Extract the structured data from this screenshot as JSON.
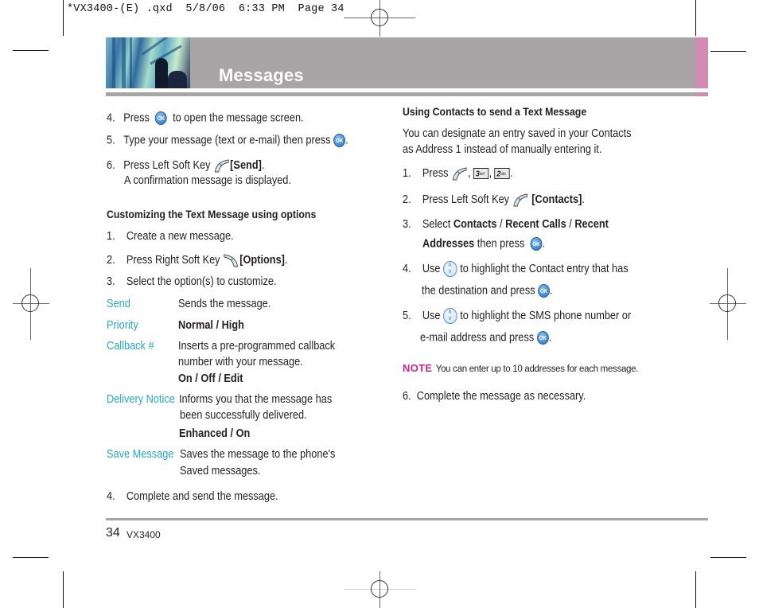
{
  "slug_line": "*VX3400-(E) .qxd  5/8/06  6:33 PM  Page 34",
  "header": {
    "title": "Messages",
    "colors": {
      "bar": "#a7a5a6",
      "accent": "#d48bb3",
      "title": "#ffffff"
    }
  },
  "left_column": {
    "steps_top": [
      {
        "num": "4.",
        "before": "Press",
        "icon": "ok-icon",
        "after": "to open the message screen."
      },
      {
        "num": "5.",
        "before": "Type your message (text or e-mail) then press",
        "icon": "ok-icon",
        "after": "."
      },
      {
        "num": "6.",
        "before": "Press Left Soft Key",
        "icon": "left-soft-key-icon",
        "bold": "[Send]",
        "after": ".",
        "line2": "A confirmation message is displayed."
      }
    ],
    "section_heading": "Customizing the Text Message using options",
    "steps_options": [
      {
        "num": "1.",
        "text": "Create a new message."
      },
      {
        "num": "2.",
        "before": "Press Right Soft Key",
        "icon": "right-soft-key-icon",
        "bold": "[Options]",
        "after": "."
      },
      {
        "num": "3.",
        "text": "Select the option(s) to customize."
      }
    ],
    "options": [
      {
        "label": "Send",
        "desc": "Sends the message."
      },
      {
        "label": "Priority",
        "values": "Normal / High"
      },
      {
        "label": "Callback #",
        "desc_line1": "Inserts a pre-programmed callback",
        "desc_line2": "number with your message.",
        "values": "On / Off / Edit"
      },
      {
        "label": "Delivery Notice",
        "desc_line1": "Informs you that the message has",
        "desc_line2": "been successfully delivered.",
        "values": "Enhanced / On"
      },
      {
        "label": "Save Message",
        "desc_line1": "Saves the message to the phone's",
        "desc_line2": "Saved messages."
      }
    ],
    "final_step": {
      "num": "4.",
      "text": "Complete and send the message."
    }
  },
  "right_column": {
    "section_heading": "Using Contacts to send a Text Message",
    "intro_line1": "You can designate an entry saved in your Contacts",
    "intro_line2": "as Address 1 instead of manually entering it.",
    "steps": [
      {
        "num": "1.",
        "before": "Press",
        "keys": [
          "left-soft-key-icon",
          "3 def",
          "2 abc"
        ],
        "key3_main": "3",
        "key3_sub": "def",
        "key2_main": "2",
        "key2_sub": "abc"
      },
      {
        "num": "2.",
        "before": "Press Left Soft Key",
        "bold": "[Contacts]",
        "after": "."
      },
      {
        "num": "3.",
        "before": "Select",
        "bold1": "Contacts",
        "sep1": " / ",
        "bold2": "Recent Calls",
        "sep2": " / ",
        "bold3": "Recent",
        "bold4": "Addresses",
        "after": "then press",
        "end": "."
      },
      {
        "num": "4.",
        "before": "Use",
        "after": "to highlight the Contact entry that has",
        "line2": "the destination and press",
        "end": "."
      },
      {
        "num": "5.",
        "before": "Use",
        "after": "to highlight the SMS phone number or",
        "line2": "e-mail address and press",
        "end": "."
      }
    ],
    "note_label": "NOTE",
    "note_text": "You can enter up to 10 addresses for each message.",
    "final_step": {
      "num": "6.",
      "text": "Complete the message as necessary."
    }
  },
  "footer": {
    "page_number": "34",
    "model": "VX3400"
  },
  "icons": {
    "ok_label": "OK"
  },
  "colors": {
    "option_label": "#26a9c2",
    "note": "#d2268c"
  }
}
